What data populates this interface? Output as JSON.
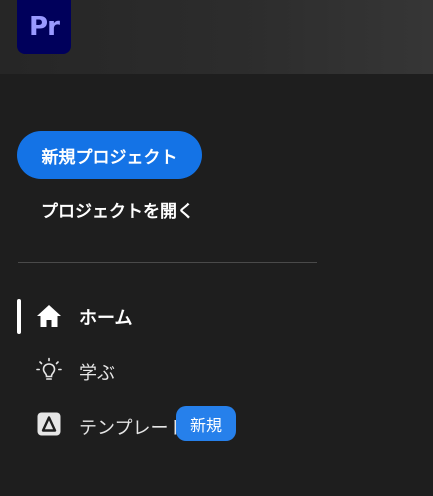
{
  "app": {
    "logo_text": "Pr",
    "logo_colors": {
      "background": "#00005b",
      "text": "#9999ff"
    }
  },
  "sidebar": {
    "new_project_label": "新規プロジェクト",
    "open_project_label": "プロジェクトを開く",
    "nav": [
      {
        "label": "ホーム",
        "icon": "home-icon",
        "active": true
      },
      {
        "label": "学ぶ",
        "icon": "lightbulb-icon",
        "active": false
      },
      {
        "label": "テンプレート",
        "icon": "adobe-express-icon",
        "active": false,
        "badge": "新規"
      }
    ]
  },
  "colors": {
    "accent": "#1473e6",
    "badge": "#2680eb",
    "background": "#1e1e1e"
  }
}
